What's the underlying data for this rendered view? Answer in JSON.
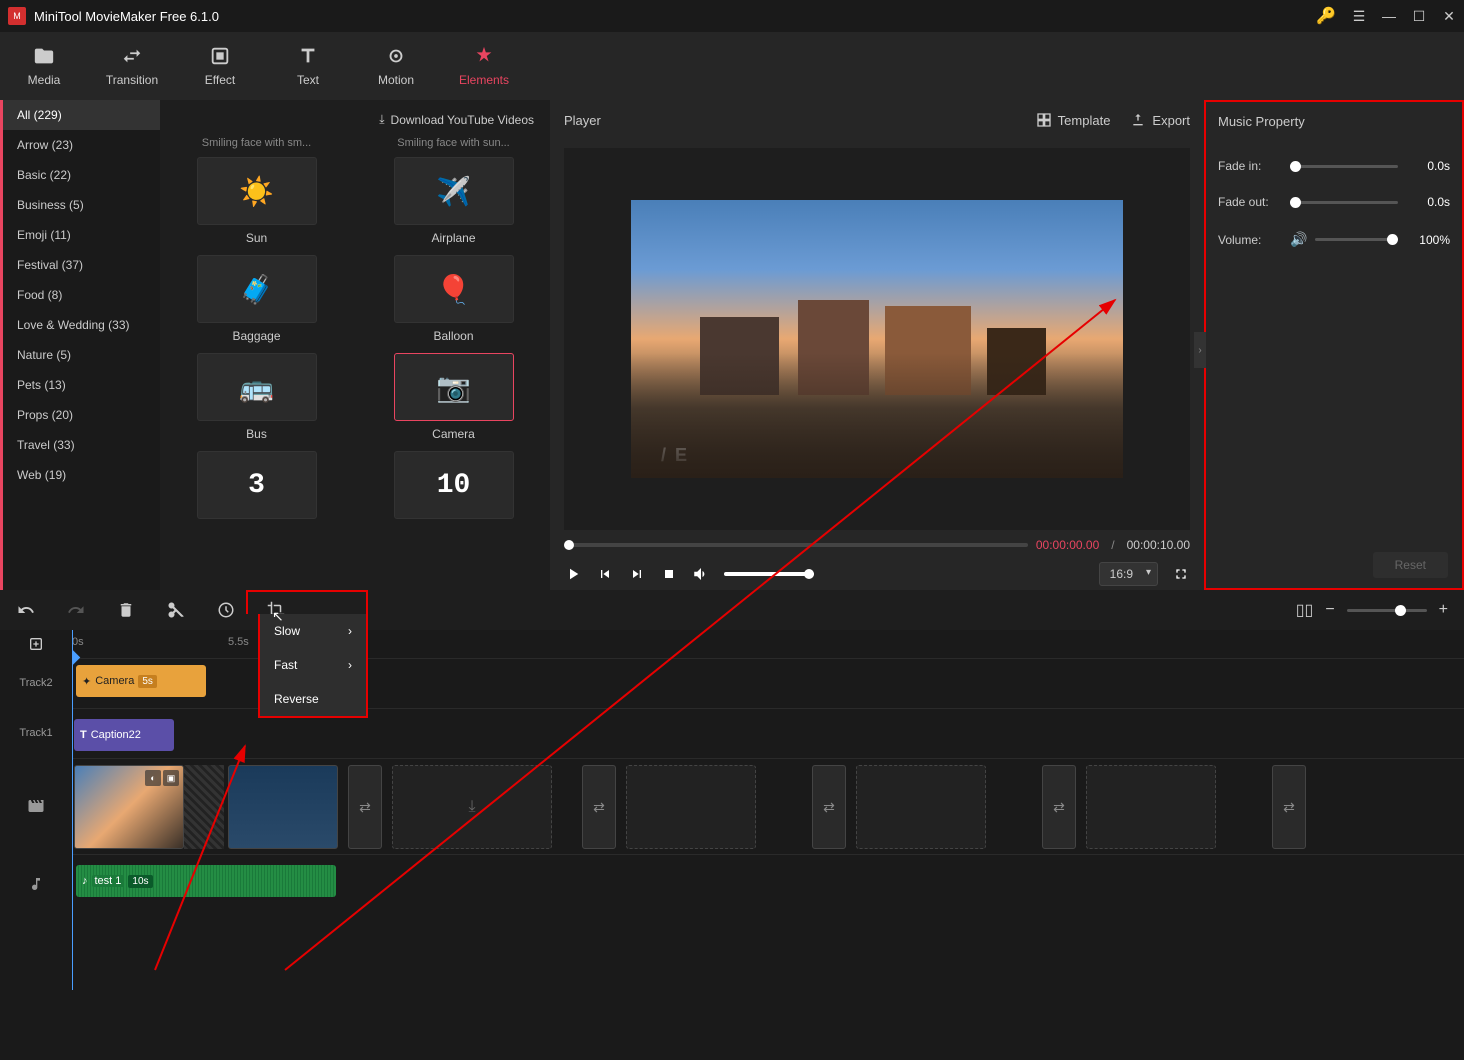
{
  "app_title": "MiniTool MovieMaker Free 6.1.0",
  "top_tabs": {
    "media": "Media",
    "transition": "Transition",
    "effect": "Effect",
    "text": "Text",
    "motion": "Motion",
    "elements": "Elements"
  },
  "categories": [
    "All (229)",
    "Arrow (23)",
    "Basic (22)",
    "Business (5)",
    "Emoji (11)",
    "Festival (37)",
    "Food (8)",
    "Love & Wedding (33)",
    "Nature (5)",
    "Pets (13)",
    "Props (20)",
    "Travel (33)",
    "Web (19)"
  ],
  "download_label": "Download YouTube Videos",
  "grid_top_labels": [
    "Smiling face with sm...",
    "Smiling face with sun..."
  ],
  "elements_grid": [
    {
      "label": "Sun",
      "icon": "☀️"
    },
    {
      "label": "Airplane",
      "icon": "✈️"
    },
    {
      "label": "Baggage",
      "icon": "🧳"
    },
    {
      "label": "Balloon",
      "icon": "🎈"
    },
    {
      "label": "Bus",
      "icon": "🚌"
    },
    {
      "label": "Camera",
      "icon": "📷",
      "selected": true
    },
    {
      "label": "",
      "icon": "3"
    },
    {
      "label": "",
      "icon": "10"
    }
  ],
  "player": {
    "title": "Player",
    "template": "Template",
    "export": "Export",
    "time_current": "00:00:00.00",
    "time_separator": "/",
    "time_total": "00:00:10.00",
    "aspect": "16:9",
    "overlay_text": "/  E"
  },
  "props": {
    "title": "Music Property",
    "fade_in": {
      "label": "Fade in:",
      "value": "0.0s"
    },
    "fade_out": {
      "label": "Fade out:",
      "value": "0.0s"
    },
    "volume": {
      "label": "Volume:",
      "value": "100%"
    },
    "reset": "Reset"
  },
  "speed_menu": {
    "slow": "Slow",
    "fast": "Fast",
    "reverse": "Reverse"
  },
  "timeline": {
    "ruler": [
      "0s",
      "5.5s"
    ],
    "track2": "Track2",
    "track1": "Track1",
    "camera_clip": "Camera",
    "camera_dur": "5s",
    "caption_clip": "Caption22",
    "audio_clip": "test 1",
    "audio_dur": "10s"
  }
}
